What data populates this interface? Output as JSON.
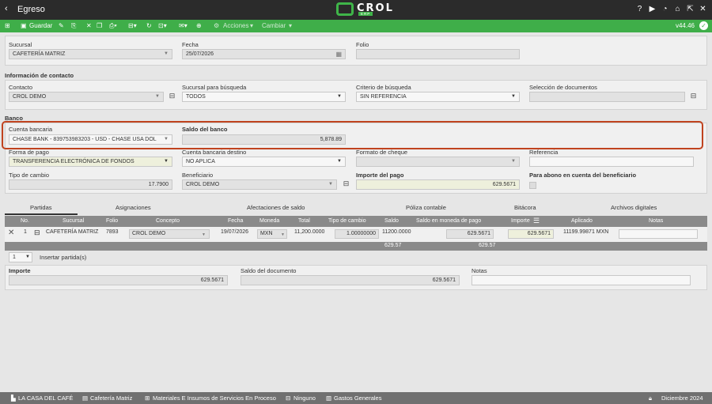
{
  "window": {
    "title": "Egreso",
    "logo_name": "CROL",
    "logo_sub": "ERP",
    "version": "v44.46"
  },
  "toolbar": {
    "save_label": "Guardar",
    "acciones_label": "Acciones",
    "cambiar_label": "Cambiar"
  },
  "header": {
    "sucursal_label": "Sucursal",
    "sucursal_value": "CAFETERÍA MATRIZ",
    "fecha_label": "Fecha",
    "fecha_value": "25/07/2026",
    "folio_label": "Folio",
    "folio_value": ""
  },
  "contacto": {
    "section": "Información de contacto",
    "contacto_label": "Contacto",
    "contacto_value": "CROL DEMO",
    "sucursal_busqueda_label": "Sucursal para búsqueda",
    "sucursal_busqueda_value": "TODOS",
    "criterio_label": "Criterio de búsqueda",
    "criterio_value": "SIN REFERENCIA",
    "seleccion_label": "Selección de documentos",
    "seleccion_value": ""
  },
  "banco": {
    "section": "Banco",
    "cuenta_label": "Cuenta bancaria",
    "cuenta_value": "CHASE BANK - 839753983203 - USD - CHASE USA DOL",
    "saldo_label": "Saldo del banco",
    "saldo_value": "5,878.89",
    "forma_label": "Forma de pago",
    "forma_value": "TRANSFERENCIA ELECTRÓNICA DE FONDOS",
    "destino_label": "Cuenta bancaria destino",
    "destino_value": "NO APLICA",
    "formato_label": "Formato de cheque",
    "formato_value": "",
    "referencia_label": "Referencia",
    "referencia_value": "",
    "tipo_cambio_label": "Tipo de cambio",
    "tipo_cambio_value": "17.7900",
    "beneficiario_label": "Beneficiario",
    "beneficiario_value": "CROL DEMO",
    "importe_label": "Importe del pago",
    "importe_value": "629.5671",
    "abono_label": "Para abono en cuenta del beneficiario"
  },
  "tabs": [
    "Partidas",
    "Asignaciones",
    "Afectaciones de saldo",
    "Póliza contable",
    "Bitácora",
    "Archivos digitales"
  ],
  "table": {
    "headers": [
      "No.",
      "Sucursal",
      "Folio",
      "Concepto",
      "Fecha",
      "Moneda",
      "Total",
      "Tipo de cambio",
      "Saldo",
      "Saldo en moneda de pago",
      "Importe",
      "Aplicado",
      "Notas"
    ],
    "row": {
      "no": "1",
      "sucursal": "CAFETERÍA MATRIZ",
      "folio": "7893",
      "concepto": "CROL DEMO",
      "fecha": "19/07/2026",
      "moneda": "MXN",
      "total": "11,200.0000",
      "tipo_cambio": "1.00000000",
      "saldo": "11200.0000",
      "saldo_moneda_pago": "629.5671",
      "importe": "629.5671",
      "aplicado": "11199.99871 MXN",
      "notas": ""
    },
    "totals": {
      "saldo": "629.57",
      "saldo_moneda_pago": "629.57"
    }
  },
  "pager": {
    "rows_value": "1",
    "insert_label": "Insertar partida(s)"
  },
  "summary": {
    "importe_label": "Importe",
    "importe_value": "629.5671",
    "saldo_doc_label": "Saldo del documento",
    "saldo_doc_value": "629.5671",
    "notas_label": "Notas",
    "notas_value": ""
  },
  "statusbar": {
    "company": "LA CASA DEL CAFÉ",
    "branch": "Cafetería Matriz",
    "category": "Materiales E Insumos de Servicios En Proceso",
    "project": "Ninguno",
    "expense": "Gastos Generales",
    "period": "Diciembre 2024"
  },
  "colors": {
    "accent": "#3fae49",
    "titlebar": "#2b2b2b",
    "highlight": "#c0431f"
  }
}
